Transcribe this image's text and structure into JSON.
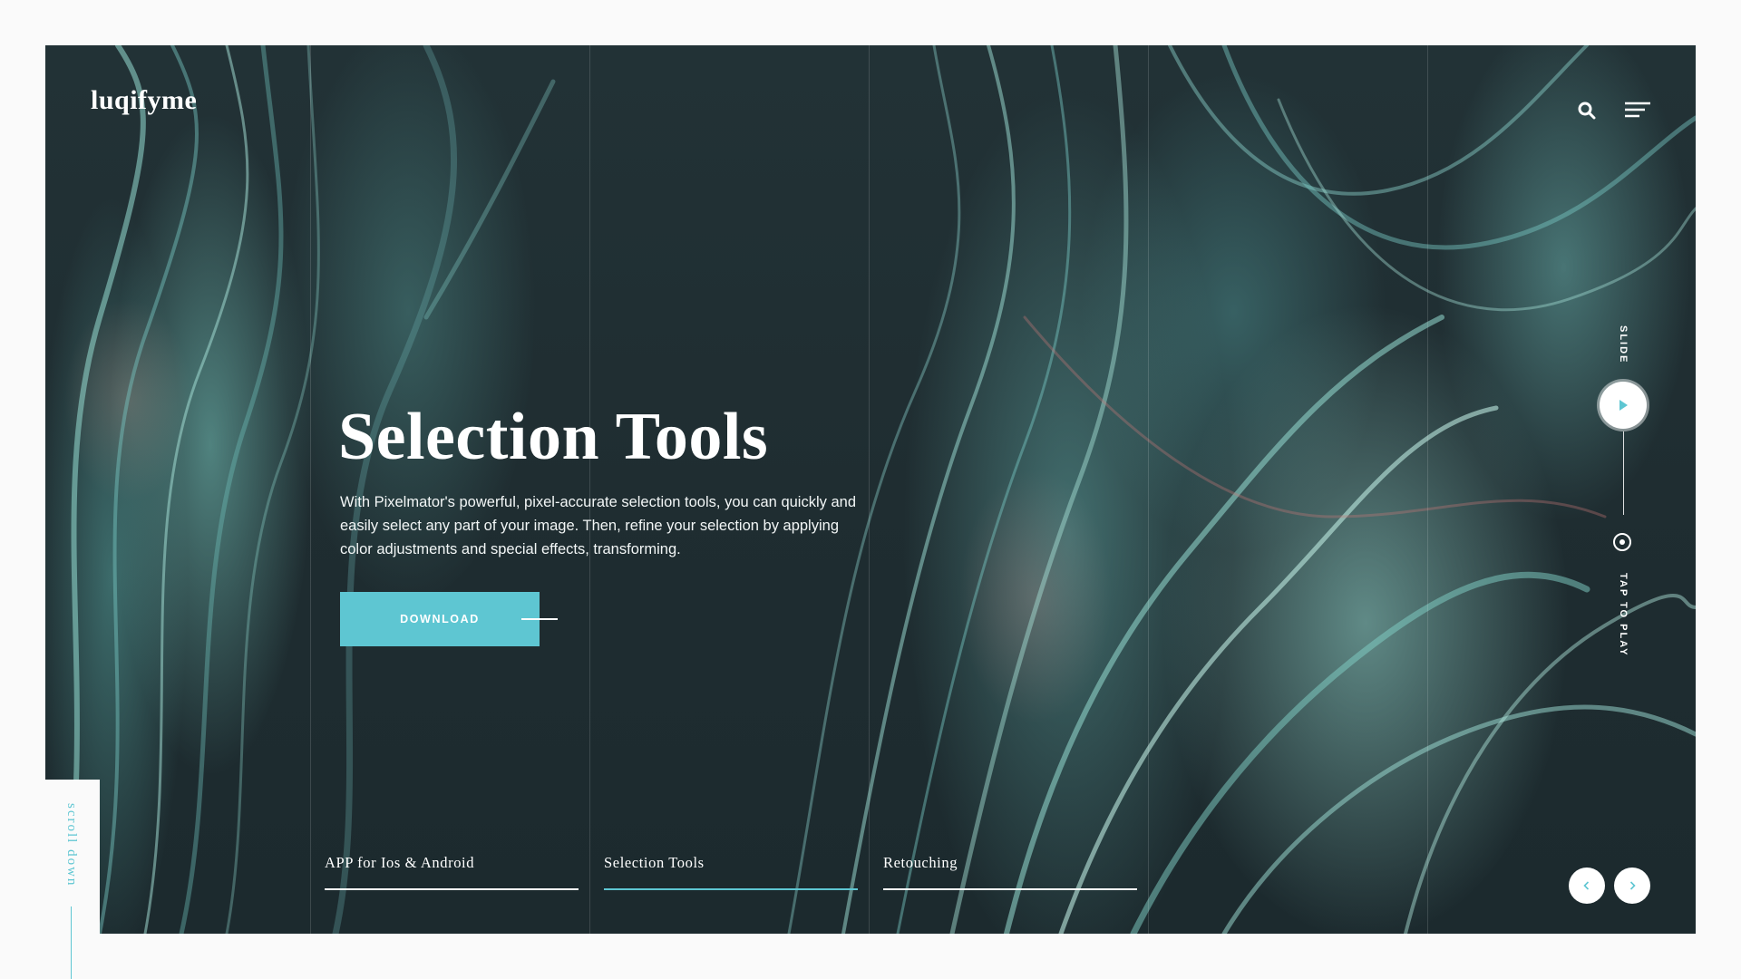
{
  "brand": {
    "logo_text": "luqifyme"
  },
  "header": {
    "search_icon": "search-icon",
    "menu_icon": "hamburger-menu-icon"
  },
  "hero": {
    "title": "Selection Tools",
    "description": "With Pixelmator's powerful, pixel-accurate selection tools, you can quickly and easily select any part of your image. Then, refine your selection by applying color adjustments and special effects, transforming.",
    "download_label": "DOWNLOAD"
  },
  "side_controls": {
    "slide_label": "SLIDE",
    "tap_label": "TAP TO PLAY"
  },
  "tabs": [
    {
      "label": "APP for Ios & Android"
    },
    {
      "label": "Selection Tools"
    },
    {
      "label": "Retouching"
    }
  ],
  "scroll": {
    "label": "scroll down"
  },
  "colors": {
    "accent": "#5ec6d2",
    "background": "#1f2d31",
    "page": "#fafafa"
  }
}
